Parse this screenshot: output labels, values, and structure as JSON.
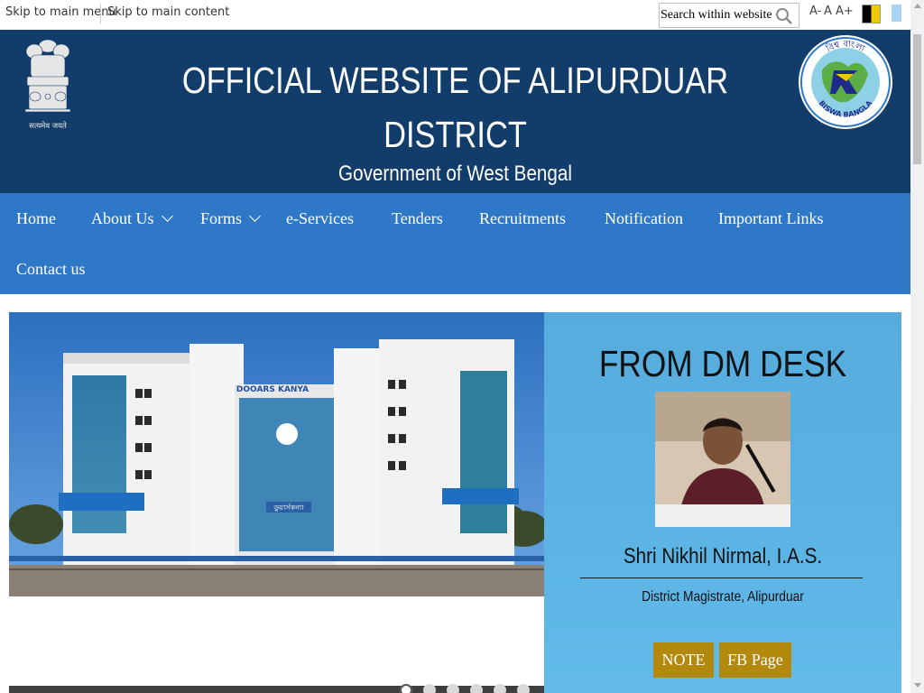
{
  "skip_links": {
    "main_menu": "Skip to main menu",
    "main_content": "Skip to main content"
  },
  "search": {
    "placeholder": "Search within website",
    "icon": "search-icon"
  },
  "font_controls": {
    "decrease": "A-",
    "normal": "A",
    "increase": "A+"
  },
  "header": {
    "title_line1": "OFFICIAL WEBSITE OF ALIPURDUAR",
    "title_line2": "DISTRICT",
    "subtitle": "Government of West Bengal",
    "emblem_motto": "सत्यमेव जयते",
    "right_logo_top": "বিশ্ব বাংলা",
    "right_logo_bottom": "BISWA BANGLA",
    "colors": {
      "header_bg": "#123d6b",
      "nav_bg": "#2f78c8"
    }
  },
  "nav": {
    "items": [
      {
        "label": "Home"
      },
      {
        "label": "About Us",
        "has_dropdown": true
      },
      {
        "label": "Forms",
        "has_dropdown": true
      },
      {
        "label": "e-Services"
      },
      {
        "label": "Tenders"
      },
      {
        "label": "Recruitments"
      },
      {
        "label": "Notification"
      },
      {
        "label": "Important Links"
      },
      {
        "label": "Contact us"
      }
    ]
  },
  "hero": {
    "building_sign_top": "DOOARS KANYA",
    "building_sign_door": "ডুয়ার্সকন্যা",
    "slider_dots": 6,
    "active_dot": 1
  },
  "dm_desk": {
    "heading": "FROM DM DESK",
    "name": "Shri Nikhil Nirmal, I.A.S.",
    "role": "District Magistrate, Alipurduar",
    "buttons": {
      "note": "NOTE",
      "fb": "FB Page"
    },
    "colors": {
      "panel": "#5bb4e4",
      "button": "#b2890d"
    }
  }
}
